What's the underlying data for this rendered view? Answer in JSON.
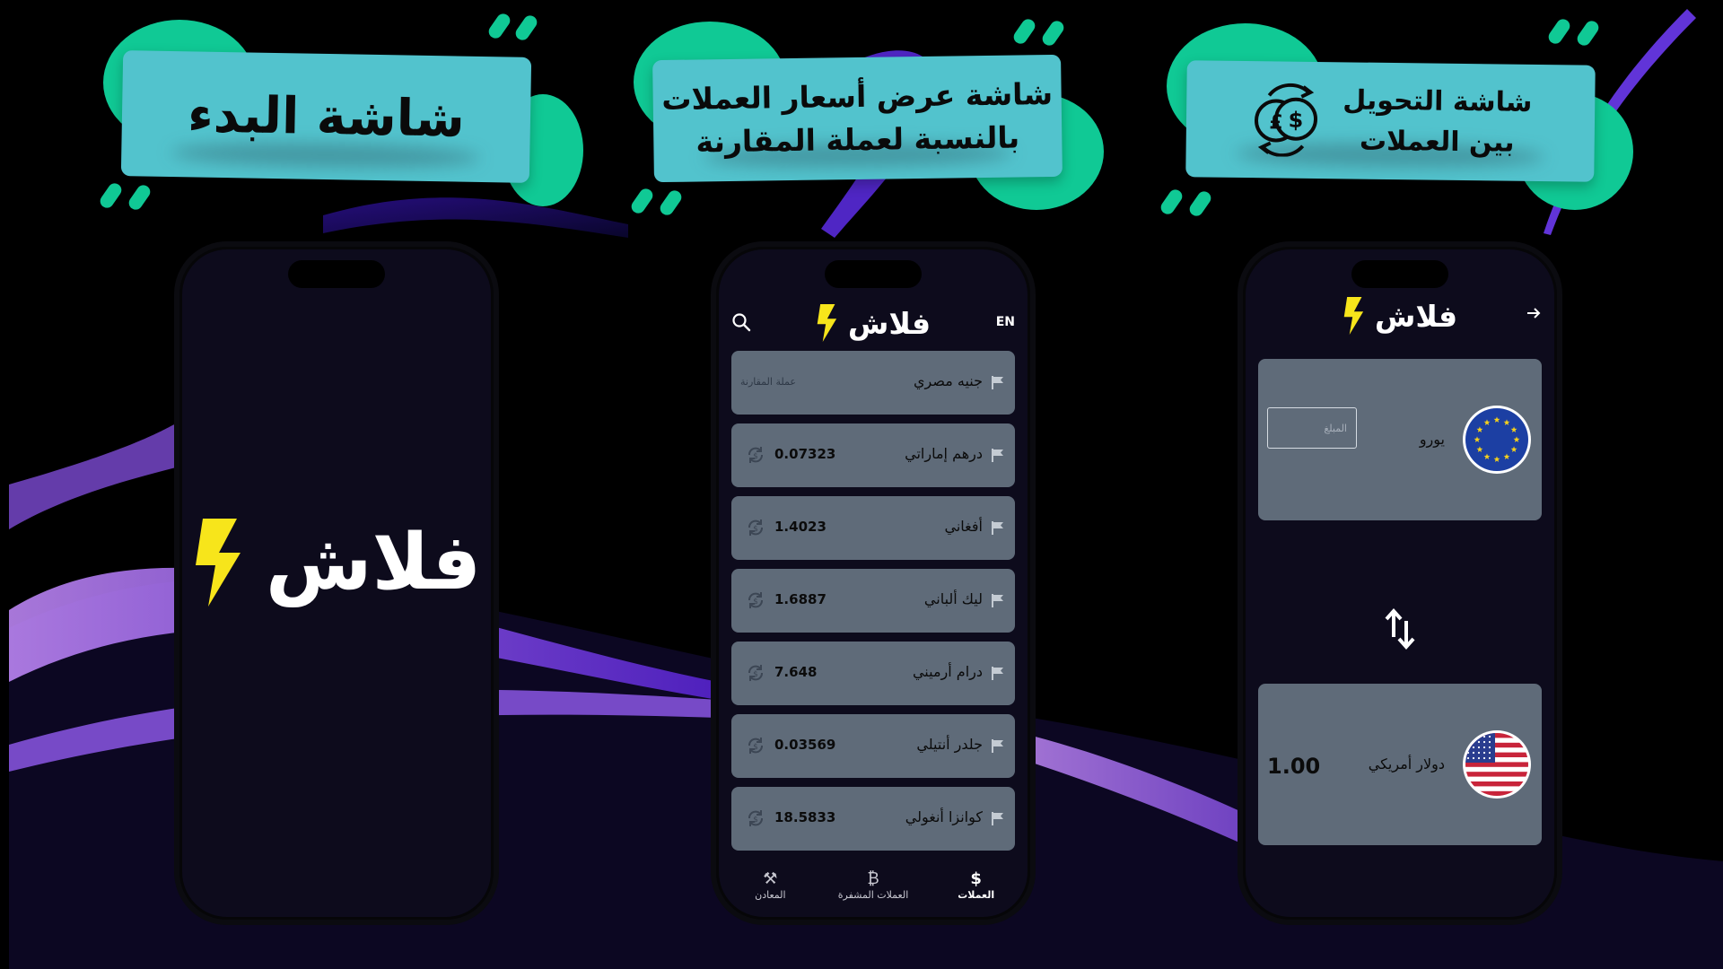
{
  "banners": {
    "splash_title": "شاشة البدء",
    "rates_title_line1": "شاشة عرض أسعار العملات",
    "rates_title_line2": "بالنسبة لعملة المقارنة",
    "converter_title_line1": "شاشة التحويل",
    "converter_title_line2": "بين العملات"
  },
  "app": {
    "name": "فلاش",
    "language_toggle": "EN"
  },
  "colors": {
    "accent": "#10c995",
    "banner": "#52c3cd",
    "card": "#5f6b79",
    "phone": "#0d0b1c",
    "bolt": "#f7e51b"
  },
  "rates": {
    "base": {
      "name": "جنيه مصري",
      "note": "عملة المقارنة"
    },
    "items": [
      {
        "name": "درهم إماراتي",
        "value": "0.07323"
      },
      {
        "name": "أفغاني",
        "value": "1.4023"
      },
      {
        "name": "ليك ألباني",
        "value": "1.6887"
      },
      {
        "name": "درام أرميني",
        "value": "7.648"
      },
      {
        "name": "جلدر أنتيلي",
        "value": "0.03569"
      },
      {
        "name": "كوانزا أنغولي",
        "value": "18.5833"
      }
    ]
  },
  "nav": {
    "currencies": "العملات",
    "crypto": "العملات المشفرة",
    "metals": "المعادن"
  },
  "converter": {
    "from_currency": "يورو",
    "amount_placeholder": "المبلغ",
    "to_currency": "دولار أمريكي",
    "result": "1.00"
  }
}
